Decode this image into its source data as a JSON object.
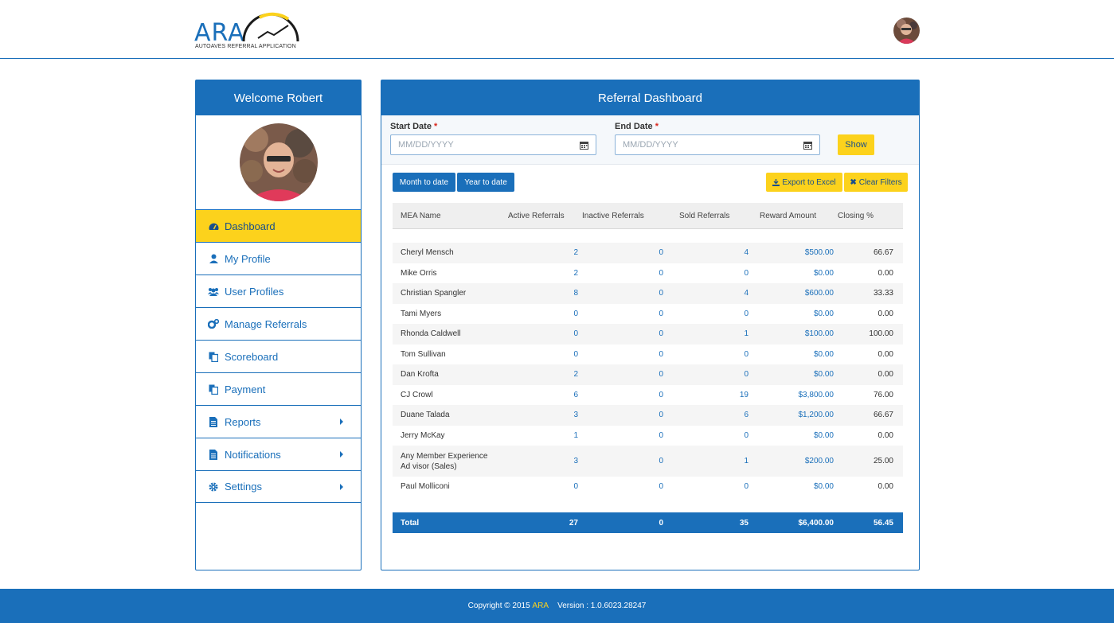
{
  "header": {
    "logo_text": "ARA",
    "logo_subtitle": "AUTOAVES REFERRAL APPLICATION",
    "avatar_icon": "user-avatar"
  },
  "sidebar": {
    "welcome": "Welcome Robert",
    "items": [
      {
        "label": "Dashboard",
        "icon": "dashboard-icon",
        "active": true
      },
      {
        "label": "My Profile",
        "icon": "user-icon"
      },
      {
        "label": "User Profiles",
        "icon": "users-icon"
      },
      {
        "label": "Manage Referrals",
        "icon": "cogs-icon"
      },
      {
        "label": "Scoreboard",
        "icon": "copy-icon"
      },
      {
        "label": "Payment",
        "icon": "copy-icon"
      },
      {
        "label": "Reports",
        "icon": "file-icon",
        "submenu": true
      },
      {
        "label": "Notifications",
        "icon": "file-icon",
        "submenu": true
      },
      {
        "label": "Settings",
        "icon": "gear-icon",
        "submenu": true
      }
    ]
  },
  "main": {
    "title": "Referral Dashboard",
    "start_date_label": "Start Date",
    "end_date_label": "End Date",
    "required_mark": "*",
    "start_date_placeholder": "MM/DD/YYYY",
    "end_date_placeholder": "MM/DD/YYYY",
    "show_label": "Show",
    "month_to_date_label": "Month to date",
    "year_to_date_label": "Year to date",
    "export_label": "Export to Excel",
    "clear_label": "Clear Filters"
  },
  "table": {
    "headers": [
      "MEA Name",
      "Active Referrals",
      "Inactive Referrals",
      "Sold Referrals",
      "Reward Amount",
      "Closing %"
    ],
    "rows": [
      [
        "Cheryl Mensch",
        "2",
        "0",
        "4",
        "$500.00",
        "66.67"
      ],
      [
        "Mike Orris",
        "2",
        "0",
        "0",
        "$0.00",
        "0.00"
      ],
      [
        "Christian Spangler",
        "8",
        "0",
        "4",
        "$600.00",
        "33.33"
      ],
      [
        "Tami Myers",
        "0",
        "0",
        "0",
        "$0.00",
        "0.00"
      ],
      [
        "Rhonda Caldwell",
        "0",
        "0",
        "1",
        "$100.00",
        "100.00"
      ],
      [
        "Tom Sullivan",
        "0",
        "0",
        "0",
        "$0.00",
        "0.00"
      ],
      [
        "Dan Krofta",
        "2",
        "0",
        "0",
        "$0.00",
        "0.00"
      ],
      [
        "CJ Crowl",
        "6",
        "0",
        "19",
        "$3,800.00",
        "76.00"
      ],
      [
        "Duane Talada",
        "3",
        "0",
        "6",
        "$1,200.00",
        "66.67"
      ],
      [
        "Jerry McKay",
        "1",
        "0",
        "0",
        "$0.00",
        "0.00"
      ],
      [
        "Any Member Experience Ad visor (Sales)",
        "3",
        "0",
        "1",
        "$200.00",
        "25.00"
      ],
      [
        "Paul Molliconi",
        "0",
        "0",
        "0",
        "$0.00",
        "0.00"
      ]
    ],
    "total": [
      "Total",
      "27",
      "0",
      "35",
      "$6,400.00",
      "56.45"
    ]
  },
  "footer": {
    "copyright_prefix": "Copyright © 2015",
    "brand": "ARA",
    "version": "Version : 1.0.6023.28247"
  },
  "colors": {
    "primary": "#1a6fba",
    "accent": "#fcd21c"
  }
}
